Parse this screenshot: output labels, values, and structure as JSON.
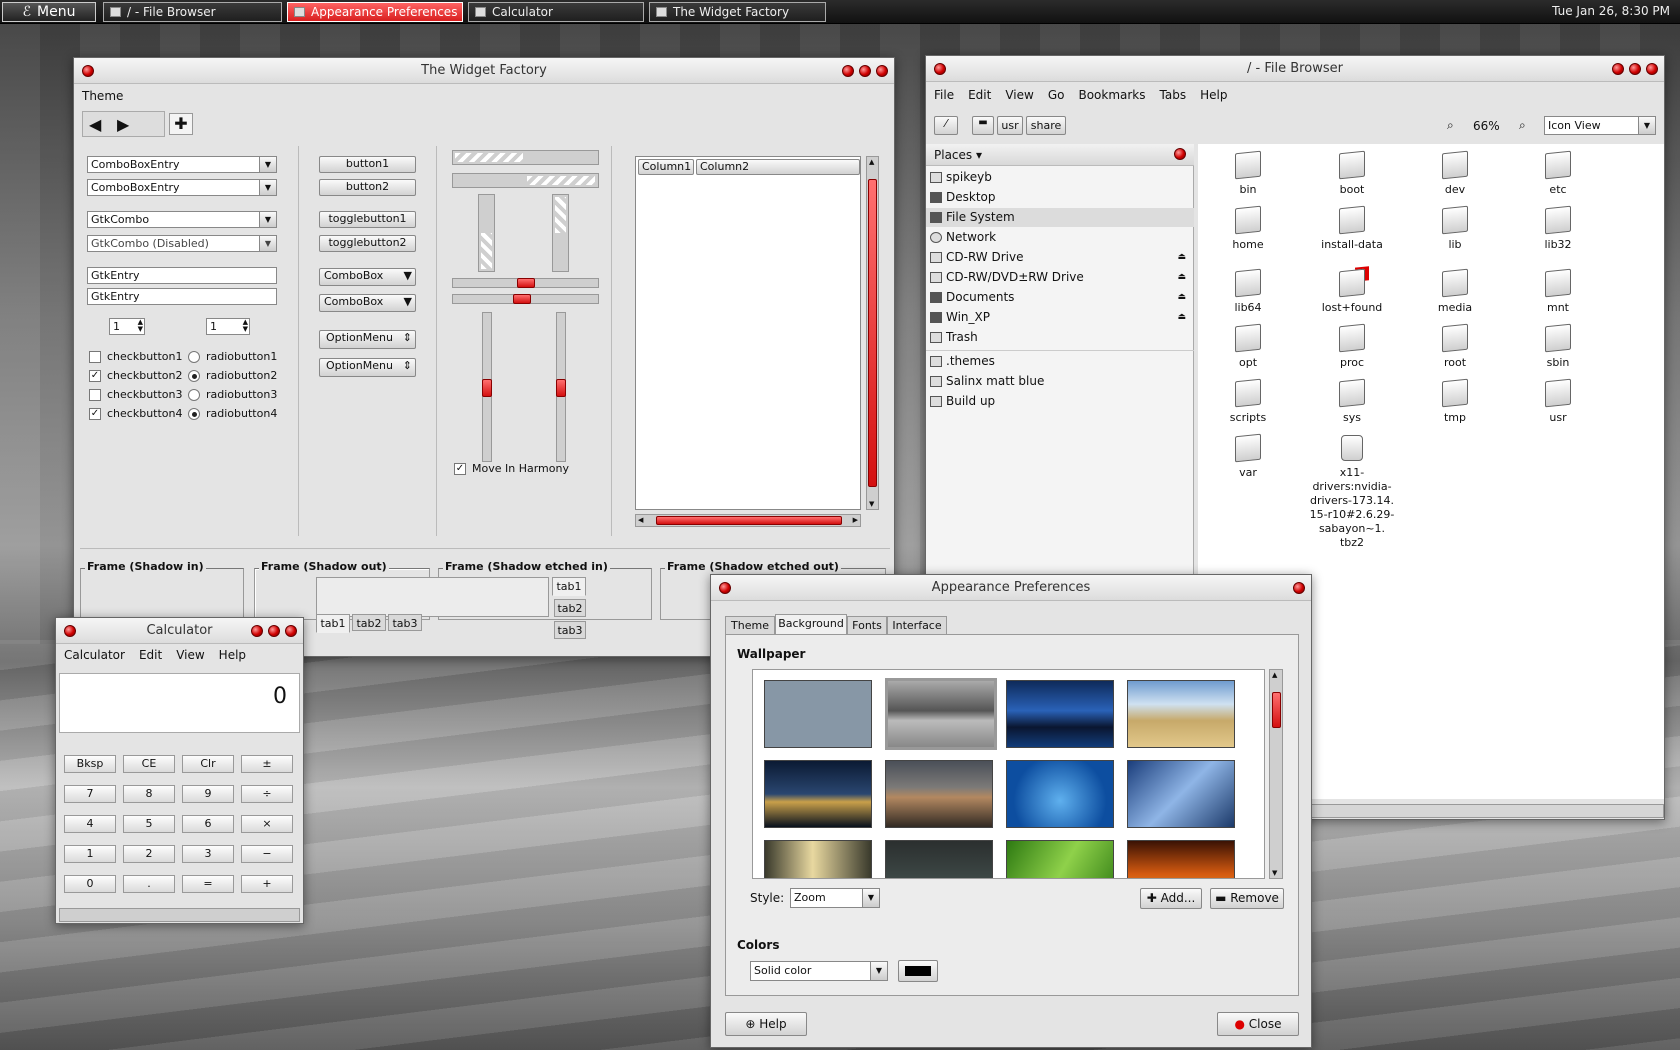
{
  "panel": {
    "menu": "Menu",
    "tasks": [
      "/ - File Browser",
      "Appearance Preferences",
      "Calculator",
      "The Widget Factory"
    ],
    "clock": "Tue Jan 26,  8:30 PM"
  },
  "widget": {
    "title": "The Widget Factory",
    "menu": "Theme",
    "combos": [
      "ComboBoxEntry",
      "ComboBoxEntry",
      "GtkCombo",
      "GtkCombo (Disabled)"
    ],
    "entries": [
      "GtkEntry",
      "GtkEntry"
    ],
    "spins": [
      "1",
      "1"
    ],
    "checks": [
      "checkbutton1",
      "checkbutton2",
      "checkbutton3",
      "checkbutton4"
    ],
    "radios": [
      "radiobutton1",
      "radiobutton2",
      "radiobutton3",
      "radiobutton4"
    ],
    "buttons": [
      "button1",
      "button2",
      "togglebutton1",
      "togglebutton2"
    ],
    "combobox": [
      "ComboBox",
      "ComboBox"
    ],
    "options": [
      "OptionMenu",
      "OptionMenu"
    ],
    "harmony": "Move In Harmony",
    "columns": [
      "Column1",
      "Column2"
    ],
    "frames": [
      "Frame (Shadow in)",
      "Frame (Shadow out)",
      "Frame (Shadow etched in)",
      "Frame (Shadow etched out)"
    ],
    "tabs": [
      "tab1",
      "tab2",
      "tab3"
    ]
  },
  "fb": {
    "title": "/ - File Browser",
    "menu": [
      "File",
      "Edit",
      "View",
      "Go",
      "Bookmarks",
      "Tabs",
      "Help"
    ],
    "path": [
      "usr",
      "share"
    ],
    "zoom": "66%",
    "view": "Icon View",
    "places_label": "Places",
    "places": [
      "spikeyb",
      "Desktop",
      "File System",
      "Network",
      "CD-RW Drive",
      "CD-RW/DVD±RW Drive",
      "Documents",
      "Win_XP",
      "Trash"
    ],
    "bookmarks": [
      ".themes",
      "Salinx matt blue",
      "Build up"
    ],
    "files": [
      "bin",
      "boot",
      "dev",
      "etc",
      "home",
      "install-data",
      "lib",
      "lib32",
      "lib64",
      "lost+found",
      "media",
      "mnt",
      "opt",
      "proc",
      "root",
      "sbin",
      "scripts",
      "sys",
      "tmp",
      "usr",
      "var"
    ],
    "archive": [
      "x11-",
      "drivers:nvidia-",
      "drivers-173.14.",
      "15-r10#2.6.29-",
      "sabayon~1.",
      "tbz2"
    ]
  },
  "calc": {
    "title": "Calculator",
    "menu": [
      "Calculator",
      "Edit",
      "View",
      "Help"
    ],
    "display": "0",
    "keys": [
      "Bksp",
      "CE",
      "Clr",
      "±",
      "7",
      "8",
      "9",
      "÷",
      "4",
      "5",
      "6",
      "×",
      "1",
      "2",
      "3",
      "−",
      "0",
      ".",
      "=",
      "+"
    ]
  },
  "ap": {
    "title": "Appearance Preferences",
    "tabs": [
      "Theme",
      "Background",
      "Fonts",
      "Interface"
    ],
    "wallpaper": "Wallpaper",
    "style_label": "Style:",
    "style": "Zoom",
    "add": "Add...",
    "remove": "Remove",
    "colors": "Colors",
    "color_mode": "Solid color",
    "help": "Help",
    "close": "Close"
  },
  "colors": {
    "accent": "#d81e1e"
  }
}
